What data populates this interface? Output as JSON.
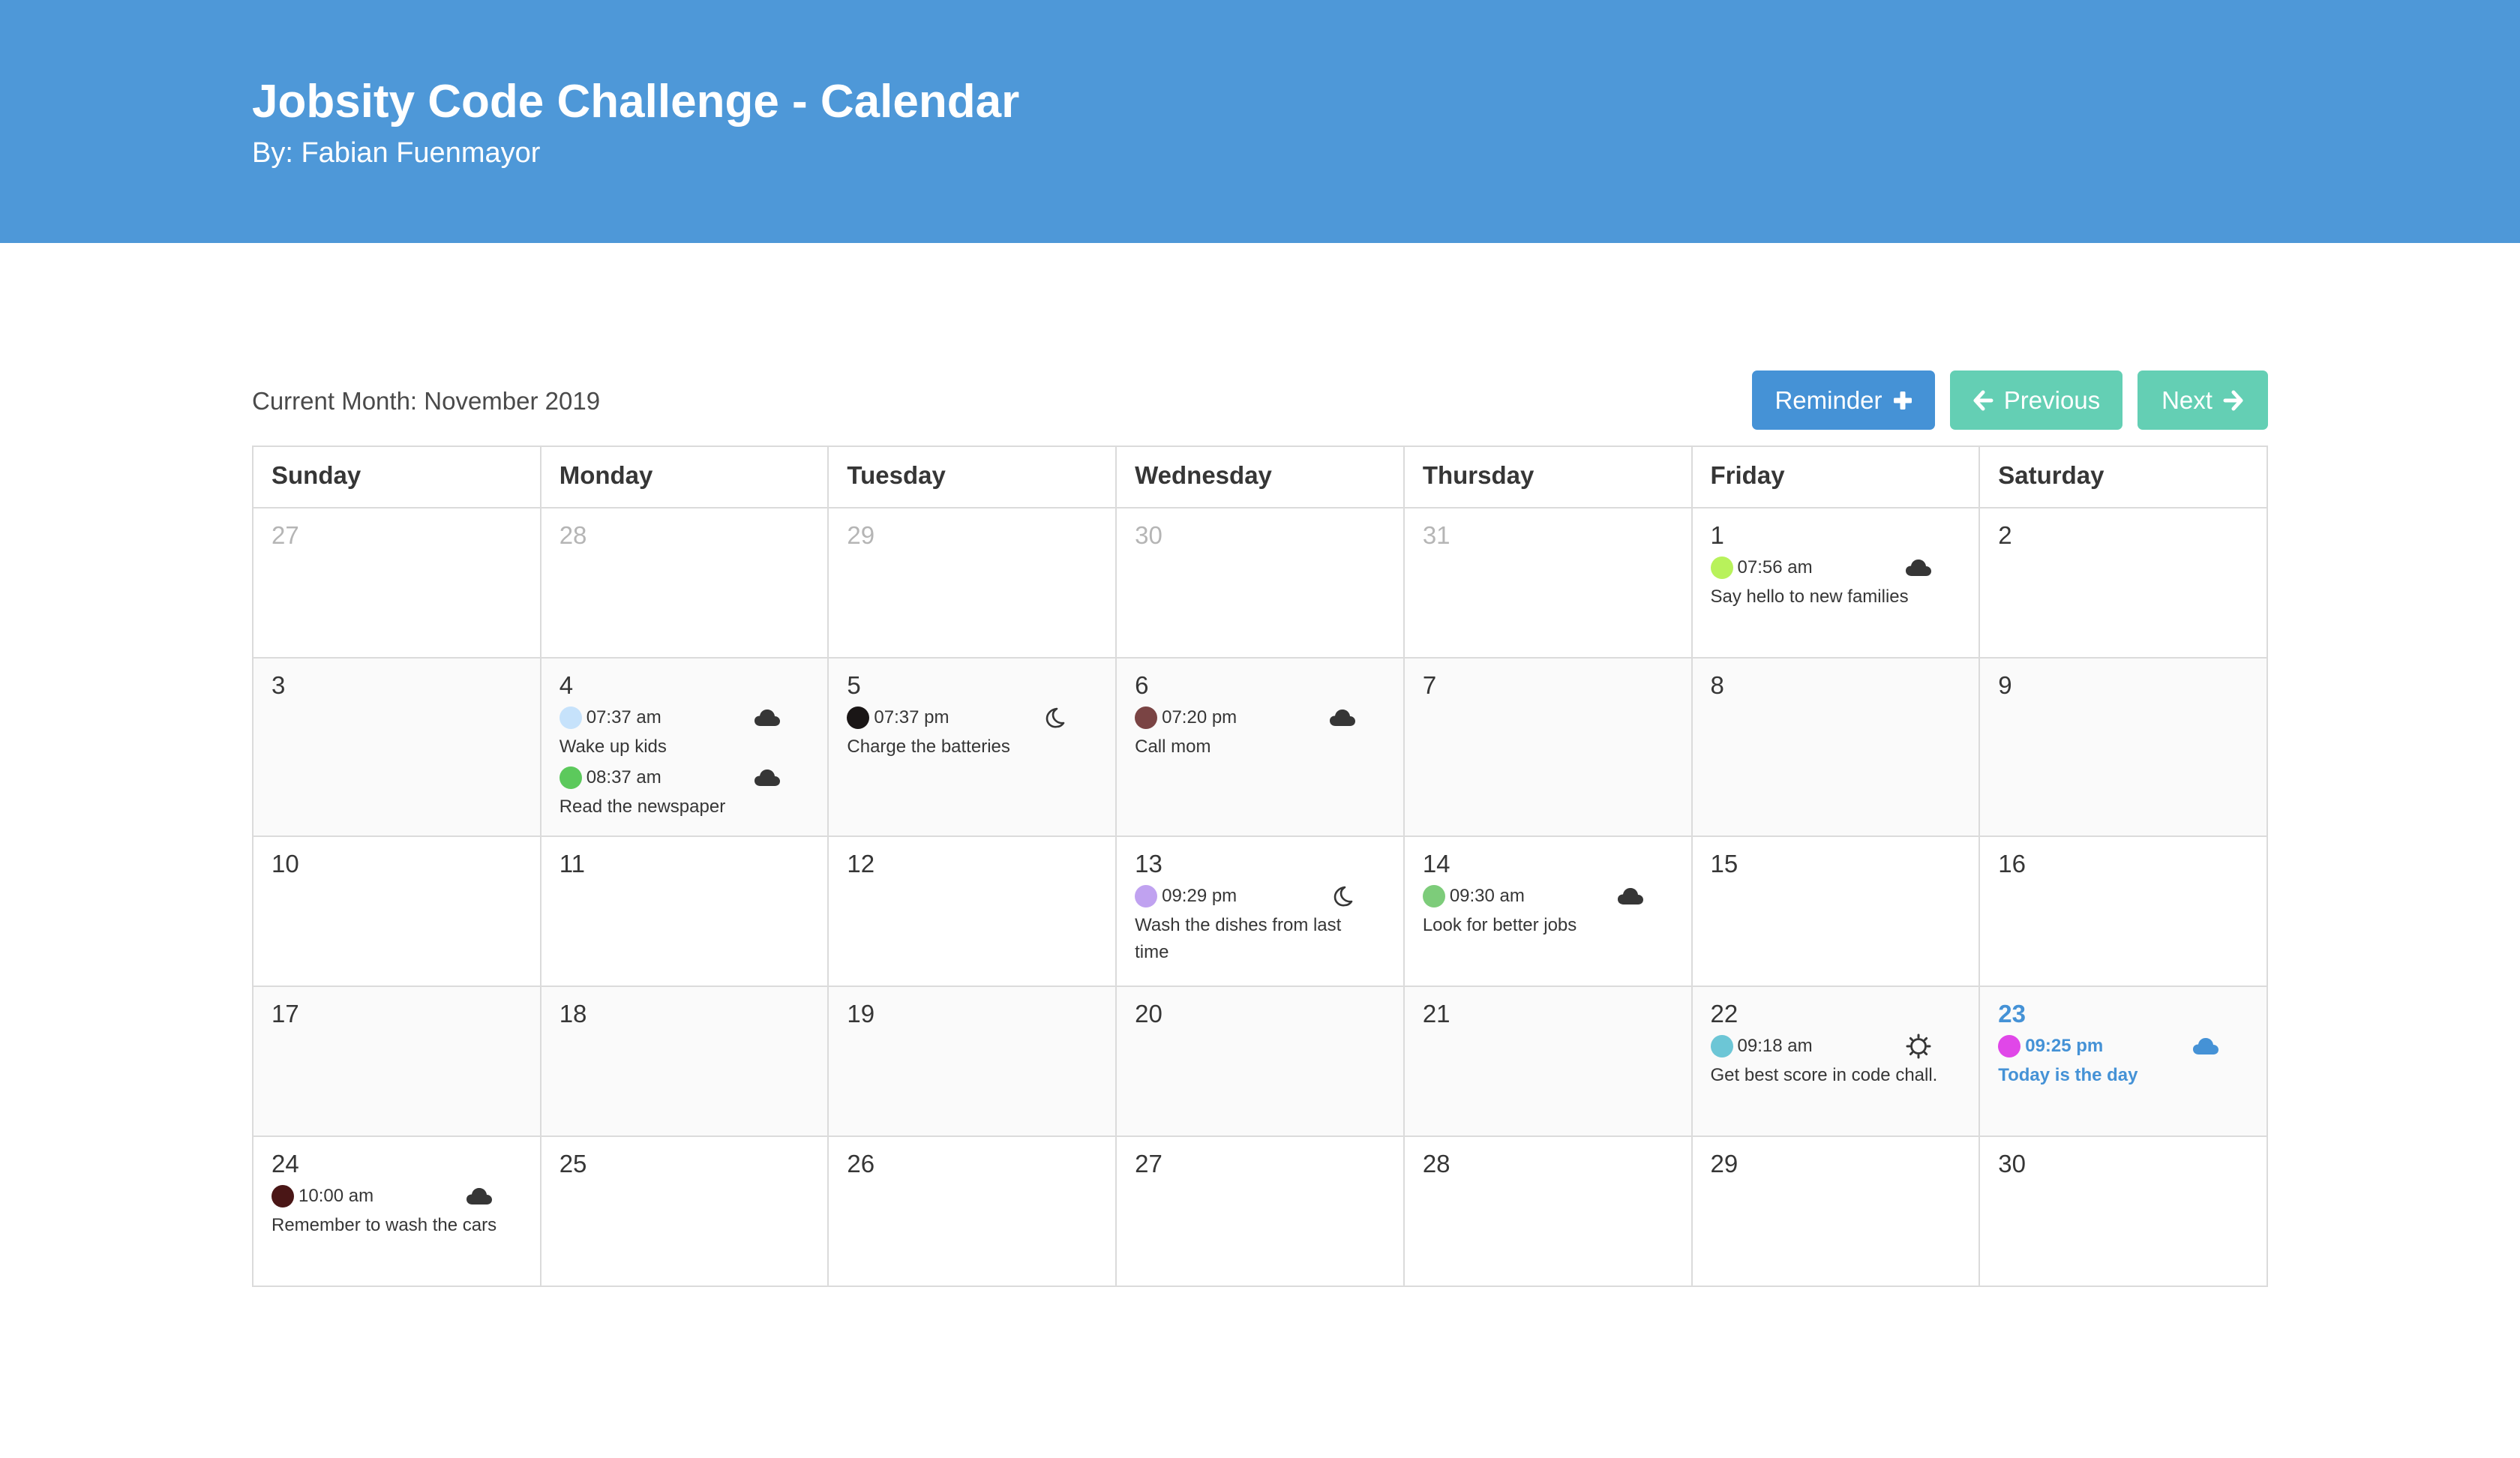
{
  "header": {
    "title": "Jobsity Code Challenge - Calendar",
    "subtitle": "By: Fabian Fuenmayor",
    "background": "#4e98d8"
  },
  "toolbar": {
    "current_month_label": "Current Month: November 2019",
    "reminder_label": "Reminder",
    "reminder_icon": "plus-icon",
    "previous_label": "Previous",
    "previous_icon": "arrow-left-icon",
    "next_label": "Next",
    "next_icon": "arrow-right-icon",
    "reminder_color": "#4592d6",
    "nav_color": "#64cfb4"
  },
  "calendar": {
    "weekdays": [
      "Sunday",
      "Monday",
      "Tuesday",
      "Wednesday",
      "Thursday",
      "Friday",
      "Saturday"
    ],
    "today_color": "#4592d6",
    "weeks": [
      [
        {
          "day": "27",
          "other_month": true,
          "reminders": []
        },
        {
          "day": "28",
          "other_month": true,
          "reminders": []
        },
        {
          "day": "29",
          "other_month": true,
          "reminders": []
        },
        {
          "day": "30",
          "other_month": true,
          "reminders": []
        },
        {
          "day": "31",
          "other_month": true,
          "reminders": []
        },
        {
          "day": "1",
          "reminders": [
            {
              "time": "07:56 am",
              "text": "Say hello to new families",
              "color": "#b8f25b",
              "weather": "cloud-icon"
            }
          ]
        },
        {
          "day": "2",
          "reminders": []
        }
      ],
      [
        {
          "day": "3",
          "reminders": []
        },
        {
          "day": "4",
          "reminders": [
            {
              "time": "07:37 am",
              "text": "Wake up kids",
              "color": "#c6e2fb",
              "weather": "cloud-icon"
            },
            {
              "time": "08:37 am",
              "text": "Read the newspaper",
              "color": "#5cc95c",
              "weather": "cloud-icon"
            }
          ]
        },
        {
          "day": "5",
          "reminders": [
            {
              "time": "07:37 pm",
              "text": "Charge the batteries",
              "color": "#1a1616",
              "weather": "moon-icon"
            }
          ]
        },
        {
          "day": "6",
          "reminders": [
            {
              "time": "07:20 pm",
              "text": "Call mom",
              "color": "#7a4444",
              "weather": "cloud-icon"
            }
          ]
        },
        {
          "day": "7",
          "reminders": []
        },
        {
          "day": "8",
          "reminders": []
        },
        {
          "day": "9",
          "reminders": []
        }
      ],
      [
        {
          "day": "10",
          "reminders": []
        },
        {
          "day": "11",
          "reminders": []
        },
        {
          "day": "12",
          "reminders": []
        },
        {
          "day": "13",
          "reminders": [
            {
              "time": "09:29 pm",
              "text": "Wash the dishes from last time",
              "color": "#c0a2f0",
              "weather": "moon-icon"
            }
          ]
        },
        {
          "day": "14",
          "reminders": [
            {
              "time": "09:30 am",
              "text": "Look for better jobs",
              "color": "#7dcc7a",
              "weather": "cloud-icon"
            }
          ]
        },
        {
          "day": "15",
          "reminders": []
        },
        {
          "day": "16",
          "reminders": []
        }
      ],
      [
        {
          "day": "17",
          "reminders": []
        },
        {
          "day": "18",
          "reminders": []
        },
        {
          "day": "19",
          "reminders": []
        },
        {
          "day": "20",
          "reminders": []
        },
        {
          "day": "21",
          "reminders": []
        },
        {
          "day": "22",
          "reminders": [
            {
              "time": "09:18 am",
              "text": "Get best score in code chall.",
              "color": "#6cc6d6",
              "weather": "sun-icon"
            }
          ]
        },
        {
          "day": "23",
          "today": true,
          "reminders": [
            {
              "time": "09:25 pm",
              "text": "Today is the day",
              "color": "#e047e8",
              "weather": "cloud-icon"
            }
          ]
        }
      ],
      [
        {
          "day": "24",
          "reminders": [
            {
              "time": "10:00 am",
              "text": "Remember to wash the cars",
              "color": "#4a1616",
              "weather": "cloud-icon"
            }
          ]
        },
        {
          "day": "25",
          "reminders": []
        },
        {
          "day": "26",
          "reminders": []
        },
        {
          "day": "27",
          "reminders": []
        },
        {
          "day": "28",
          "reminders": []
        },
        {
          "day": "29",
          "reminders": []
        },
        {
          "day": "30",
          "reminders": []
        }
      ]
    ]
  }
}
